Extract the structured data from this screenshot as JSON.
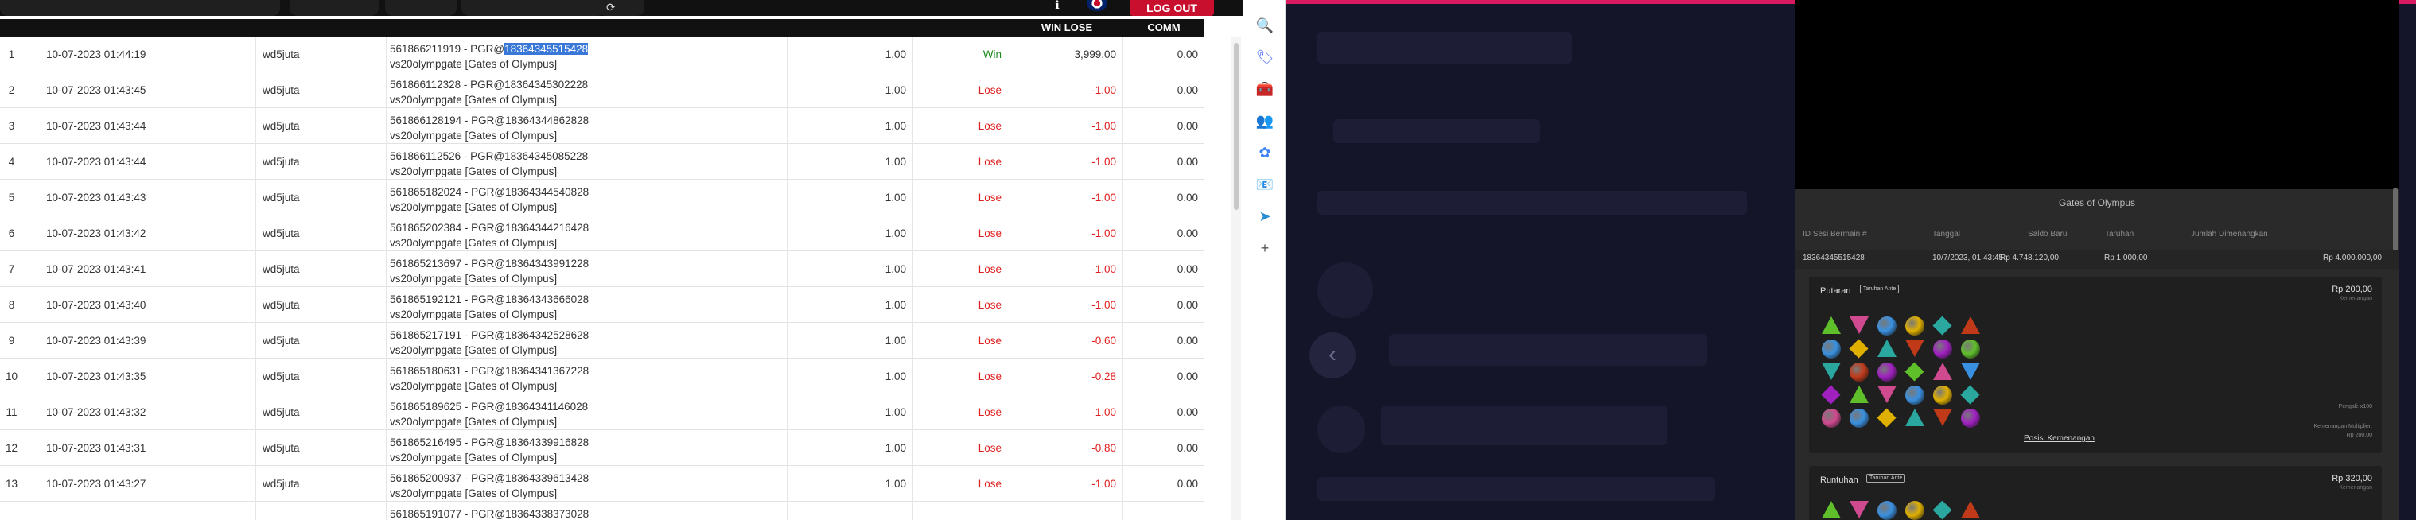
{
  "topbar": {
    "account_text": "",
    "pill2_text": "",
    "pill3_text": "",
    "balance_text": "",
    "logout_label": "LOG OUT"
  },
  "table": {
    "headers": {
      "no": "",
      "date": "",
      "user": "",
      "detail": "",
      "stake": "",
      "status": "",
      "winlose": "WIN LOSE",
      "comm": "COMM"
    },
    "rows": [
      {
        "no": "1",
        "date": "10-07-2023 01:44:19",
        "user": "wd5juta",
        "ref_prefix": "561866211919 - PGR@",
        "ref_id": "18364345515428",
        "game": "vs20olympgate [Gates of Olympus]",
        "stake": "1.00",
        "status": "Win",
        "winlose": "3,999.00",
        "comm": "0.00",
        "selected": true
      },
      {
        "no": "2",
        "date": "10-07-2023 01:43:45",
        "user": "wd5juta",
        "ref_prefix": "561866112328 - PGR@",
        "ref_id": "18364345302228",
        "game": "vs20olympgate [Gates of Olympus]",
        "stake": "1.00",
        "status": "Lose",
        "winlose": "-1.00",
        "comm": "0.00"
      },
      {
        "no": "3",
        "date": "10-07-2023 01:43:44",
        "user": "wd5juta",
        "ref_prefix": "561866128194 - PGR@",
        "ref_id": "18364344862828",
        "game": "vs20olympgate [Gates of Olympus]",
        "stake": "1.00",
        "status": "Lose",
        "winlose": "-1.00",
        "comm": "0.00"
      },
      {
        "no": "4",
        "date": "10-07-2023 01:43:44",
        "user": "wd5juta",
        "ref_prefix": "561866112526 - PGR@",
        "ref_id": "18364345085228",
        "game": "vs20olympgate [Gates of Olympus]",
        "stake": "1.00",
        "status": "Lose",
        "winlose": "-1.00",
        "comm": "0.00"
      },
      {
        "no": "5",
        "date": "10-07-2023 01:43:43",
        "user": "wd5juta",
        "ref_prefix": "561865182024 - PGR@",
        "ref_id": "18364344540828",
        "game": "vs20olympgate [Gates of Olympus]",
        "stake": "1.00",
        "status": "Lose",
        "winlose": "-1.00",
        "comm": "0.00"
      },
      {
        "no": "6",
        "date": "10-07-2023 01:43:42",
        "user": "wd5juta",
        "ref_prefix": "561865202384 - PGR@",
        "ref_id": "18364344216428",
        "game": "vs20olympgate [Gates of Olympus]",
        "stake": "1.00",
        "status": "Lose",
        "winlose": "-1.00",
        "comm": "0.00"
      },
      {
        "no": "7",
        "date": "10-07-2023 01:43:41",
        "user": "wd5juta",
        "ref_prefix": "561865213697 - PGR@",
        "ref_id": "18364343991228",
        "game": "vs20olympgate [Gates of Olympus]",
        "stake": "1.00",
        "status": "Lose",
        "winlose": "-1.00",
        "comm": "0.00"
      },
      {
        "no": "8",
        "date": "10-07-2023 01:43:40",
        "user": "wd5juta",
        "ref_prefix": "561865192121 - PGR@",
        "ref_id": "18364343666028",
        "game": "vs20olympgate [Gates of Olympus]",
        "stake": "1.00",
        "status": "Lose",
        "winlose": "-1.00",
        "comm": "0.00"
      },
      {
        "no": "9",
        "date": "10-07-2023 01:43:39",
        "user": "wd5juta",
        "ref_prefix": "561865217191 - PGR@",
        "ref_id": "18364342528628",
        "game": "vs20olympgate [Gates of Olympus]",
        "stake": "1.00",
        "status": "Lose",
        "winlose": "-0.60",
        "comm": "0.00"
      },
      {
        "no": "10",
        "date": "10-07-2023 01:43:35",
        "user": "wd5juta",
        "ref_prefix": "561865180631 - PGR@",
        "ref_id": "18364341367228",
        "game": "vs20olympgate [Gates of Olympus]",
        "stake": "1.00",
        "status": "Lose",
        "winlose": "-0.28",
        "comm": "0.00"
      },
      {
        "no": "11",
        "date": "10-07-2023 01:43:32",
        "user": "wd5juta",
        "ref_prefix": "561865189625 - PGR@",
        "ref_id": "18364341146028",
        "game": "vs20olympgate [Gates of Olympus]",
        "stake": "1.00",
        "status": "Lose",
        "winlose": "-1.00",
        "comm": "0.00"
      },
      {
        "no": "12",
        "date": "10-07-2023 01:43:31",
        "user": "wd5juta",
        "ref_prefix": "561865216495 - PGR@",
        "ref_id": "18364339916828",
        "game": "vs20olympgate [Gates of Olympus]",
        "stake": "1.00",
        "status": "Lose",
        "winlose": "-0.80",
        "comm": "0.00"
      },
      {
        "no": "13",
        "date": "10-07-2023 01:43:27",
        "user": "wd5juta",
        "ref_prefix": "561865200937 - PGR@",
        "ref_id": "18364339613428",
        "game": "vs20olympgate [Gates of Olympus]",
        "stake": "1.00",
        "status": "Lose",
        "winlose": "-1.00",
        "comm": "0.00"
      },
      {
        "no": "",
        "date": "",
        "user": "",
        "ref_prefix": "561865191077 - PGR@",
        "ref_id": "18364338373028",
        "game": "",
        "stake": "",
        "status": "",
        "winlose": "",
        "comm": ""
      }
    ]
  },
  "sidebar_icons": [
    "search-icon",
    "tag-icon",
    "toolbox-icon",
    "people-icon",
    "copilot-icon",
    "outlook-icon",
    "send-icon",
    "add-icon"
  ],
  "game_panel": {
    "title": "Gates of Olympus",
    "headers": [
      "ID Sesi Bermain #",
      "Tanggal",
      "Saldo Baru",
      "Taruhan",
      "Jumlah Dimenangkan"
    ],
    "values": [
      "18364345515428",
      "10/7/2023, 01:43:45",
      "Rp 4.748.120,00",
      "Rp 1.000,00",
      "Rp 4.000.000,00"
    ],
    "spin_label": "Putaran",
    "spin_badge": "Taruhan Ante",
    "spin_amount": "Rp 200,00",
    "spin_amount_sub": "Kemenangan",
    "spin_right_lines": [
      "Pengali: x100",
      "Kemenangan Multiplier:",
      "Rp 200,00"
    ],
    "paytable_link": "Posisi Kemenangan",
    "tumble_label": "Runtuhan",
    "tumble_badge": "Taruhan Ante",
    "tumble_amount": "Rp 320,00",
    "tumble_amount_sub": "Kemenangan"
  },
  "colors": {
    "win": "#1f8a1f",
    "lose": "#e02020",
    "selection": "#3a78d8",
    "logout": "#c8102e",
    "accent_pink": "#d81b60"
  }
}
